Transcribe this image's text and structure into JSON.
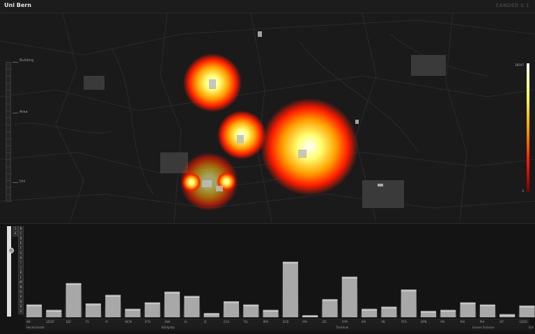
{
  "app": {
    "title": "Uni Bern",
    "version": "CANDED 0.1"
  },
  "zoom": {
    "labels": [
      "Building",
      "Area",
      "Uni"
    ]
  },
  "legend": {
    "max": "29197",
    "min": "0"
  },
  "filter_buttons": [
    "1",
    "A",
    "B",
    "C",
    "D",
    "E",
    "F",
    "G",
    "H",
    "I",
    "J",
    "K",
    "L",
    "M",
    "N",
    "O",
    "P",
    "Q",
    "R",
    "S"
  ],
  "bars": {
    "labels": [
      "INF",
      "IZENT",
      "DSF",
      "FS",
      "IP",
      "MCM",
      "IFTA",
      "ANA",
      "IG",
      "ZI",
      "ECH",
      "TIG",
      "IRM",
      "DCB",
      "IPH",
      "IZE",
      "FPM",
      "IMI",
      "IW",
      "ITFA",
      "DPN",
      "IPA",
      "PHI",
      "PHI",
      "IAT",
      "GEOB"
    ],
    "values": [
      120,
      70,
      320,
      130,
      210,
      80,
      140,
      240,
      200,
      40,
      150,
      120,
      70,
      520,
      20,
      170,
      380,
      80,
      100,
      260,
      60,
      70,
      140,
      120,
      30,
      110
    ],
    "group_labels": [
      "Hochschulstr",
      "Bühlplatz",
      "Tierklinik",
      "Grosse Schanze",
      "Sch"
    ]
  }
}
